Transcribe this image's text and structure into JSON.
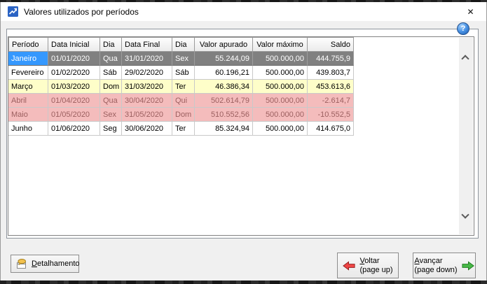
{
  "window": {
    "title": "Valores utilizados por períodos",
    "close_glyph": "✕",
    "help_glyph": "?"
  },
  "table": {
    "columns": [
      "Período",
      "Data Inicial",
      "Dia",
      "Data Final",
      "Dia",
      "Valor apurado",
      "Valor máximo",
      "Saldo"
    ],
    "rows": [
      {
        "period": "Janeiro",
        "data_inicial": "01/01/2020",
        "dia_inicial": "Qua",
        "data_final": "31/01/2020",
        "dia_final": "Sex",
        "valor_apurado": "55.244,09",
        "valor_maximo": "500.000,00",
        "saldo": "444.755,9",
        "state": "selected"
      },
      {
        "period": "Fevereiro",
        "data_inicial": "01/02/2020",
        "dia_inicial": "Sáb",
        "data_final": "29/02/2020",
        "dia_final": "Sáb",
        "valor_apurado": "60.196,21",
        "valor_maximo": "500.000,00",
        "saldo": "439.803,7",
        "state": "normal"
      },
      {
        "period": "Março",
        "data_inicial": "01/03/2020",
        "dia_inicial": "Dom",
        "data_final": "31/03/2020",
        "dia_final": "Ter",
        "valor_apurado": "46.386,34",
        "valor_maximo": "500.000,00",
        "saldo": "453.613,6",
        "state": "warning"
      },
      {
        "period": "Abril",
        "data_inicial": "01/04/2020",
        "dia_inicial": "Qua",
        "data_final": "30/04/2020",
        "dia_final": "Qui",
        "valor_apurado": "502.614,79",
        "valor_maximo": "500.000,00",
        "saldo": "-2.614,7",
        "state": "negative"
      },
      {
        "period": "Maio",
        "data_inicial": "01/05/2020",
        "dia_inicial": "Sex",
        "data_final": "31/05/2020",
        "dia_final": "Dom",
        "valor_apurado": "510.552,56",
        "valor_maximo": "500.000,00",
        "saldo": "-10.552,5",
        "state": "negative"
      },
      {
        "period": "Junho",
        "data_inicial": "01/06/2020",
        "dia_inicial": "Seg",
        "data_final": "30/06/2020",
        "dia_final": "Ter",
        "valor_apurado": "85.324,94",
        "valor_maximo": "500.000,00",
        "saldo": "414.675,0",
        "state": "normal"
      }
    ]
  },
  "buttons": {
    "detalhamento": {
      "accel": "D",
      "rest": "etalhamento"
    },
    "voltar": {
      "accel": "V",
      "rest": "oltar",
      "sub": "(page up)"
    },
    "avancar": {
      "accel": "A",
      "rest": "vançar",
      "sub": "(page down)"
    }
  },
  "icons": {
    "app": "trend-chart",
    "help": "question-mark",
    "close": "close-x",
    "detalhamento": "note-balloon",
    "voltar": "red-left-arrow",
    "avancar": "green-right-arrow",
    "scroll_up": "chevron-up",
    "scroll_down": "chevron-down"
  },
  "colors": {
    "titlebar": "#FFFFFF",
    "dialog_bg": "#F0F0F0",
    "selected_cell": "#3598FE",
    "selected_row": "#808080",
    "warning_row": "#FEFEC9",
    "negative_row": "#F4BCBC",
    "negative_text": "#9B5F5F"
  }
}
